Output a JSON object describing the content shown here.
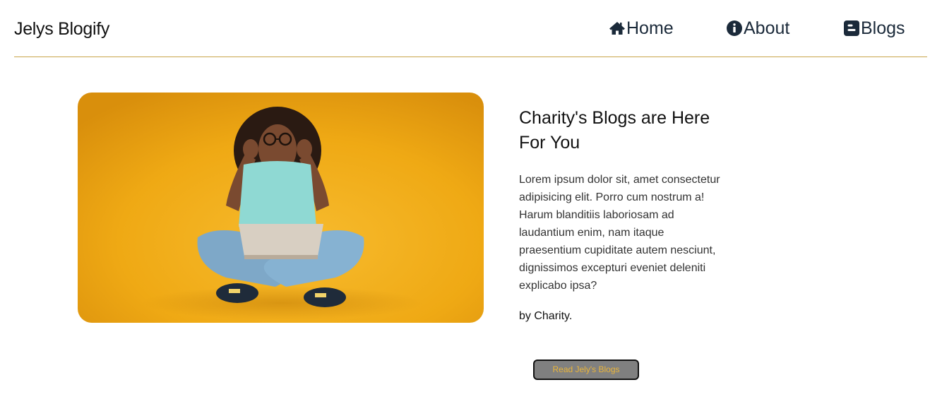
{
  "header": {
    "brand": "Jelys Blogify",
    "nav": [
      {
        "label": "Home",
        "icon": "home-icon"
      },
      {
        "label": "About",
        "icon": "info-circle-icon"
      },
      {
        "label": "Blogs",
        "icon": "blogger-icon"
      }
    ],
    "divider_color": "#c9a54a"
  },
  "hero": {
    "image": "woman-with-laptop-photo",
    "background_color": "#f0aa14"
  },
  "main": {
    "title": "Charity's Blogs are Here For You",
    "body": "Lorem ipsum dolor sit, amet consectetur adipisicing elit. Porro cum nostrum a! Harum blanditiis laboriosam ad laudantium enim, nam itaque praesentium cupiditate autem nesciunt, dignissimos excepturi eveniet deleniti explicabo ipsa?",
    "author": "by Charity.",
    "button_label": "Read Jely's Blogs",
    "button_text_color": "#e9b43a",
    "button_bg_color": "#808080"
  }
}
